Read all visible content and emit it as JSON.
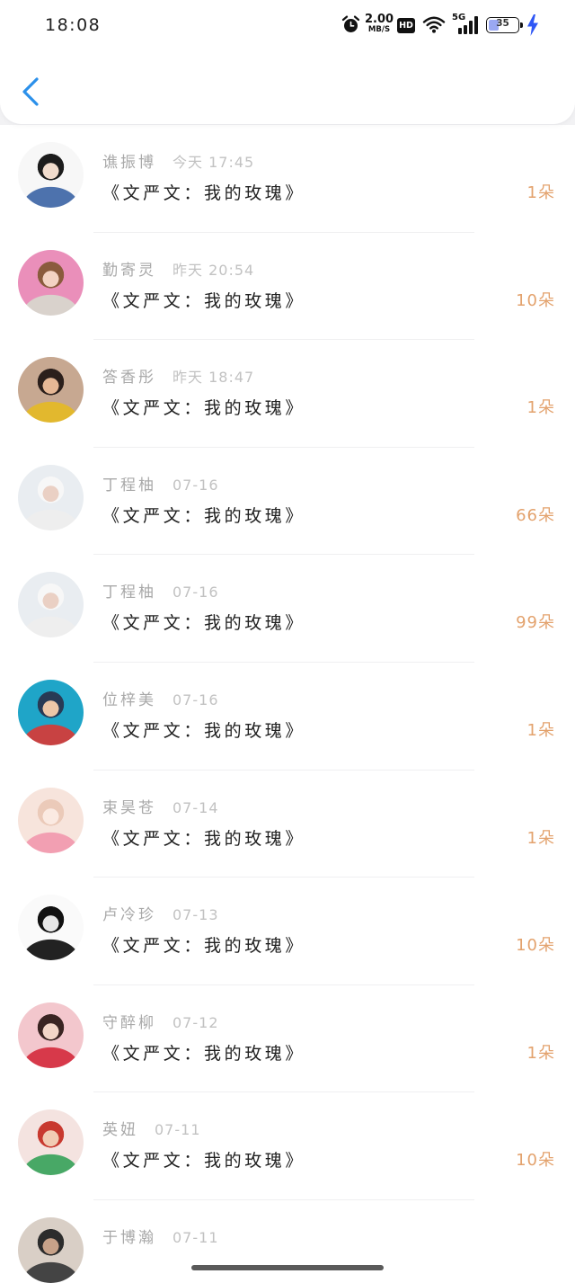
{
  "status_bar": {
    "time": "18:08",
    "net_speed_value": "2.00",
    "net_speed_unit": "MB/S",
    "hd_label": "HD",
    "network_type": "5G",
    "battery_level": "35",
    "icons": [
      "alarm-icon",
      "wifi-icon",
      "signal-icon",
      "battery-icon",
      "charging-icon"
    ]
  },
  "header": {
    "back_icon": "chevron-left-icon"
  },
  "colors": {
    "accent": "#2b90ea",
    "amount": "#e3a26d",
    "name": "#a9a9a9",
    "time": "#c2c2c2",
    "title": "#1f1f1f",
    "charging": "#2f57f5"
  },
  "list": {
    "items": [
      {
        "name": "谯振博",
        "time": "今天 17:45",
        "title": "《文严文：我的玫瑰》",
        "amount": "1朵"
      },
      {
        "name": "勤寄灵",
        "time": "昨天 20:54",
        "title": "《文严文：我的玫瑰》",
        "amount": "10朵"
      },
      {
        "name": "答香彤",
        "time": "昨天 18:47",
        "title": "《文严文：我的玫瑰》",
        "amount": "1朵"
      },
      {
        "name": "丁程柚",
        "time": "07-16",
        "title": "《文严文：我的玫瑰》",
        "amount": "66朵"
      },
      {
        "name": "丁程柚",
        "time": "07-16",
        "title": "《文严文：我的玫瑰》",
        "amount": "99朵"
      },
      {
        "name": "位梓美",
        "time": "07-16",
        "title": "《文严文：我的玫瑰》",
        "amount": "1朵"
      },
      {
        "name": "束昊苍",
        "time": "07-14",
        "title": "《文严文：我的玫瑰》",
        "amount": "1朵"
      },
      {
        "name": "卢冷珍",
        "time": "07-13",
        "title": "《文严文：我的玫瑰》",
        "amount": "10朵"
      },
      {
        "name": "守醉柳",
        "time": "07-12",
        "title": "《文严文：我的玫瑰》",
        "amount": "1朵"
      },
      {
        "name": "英妞",
        "time": "07-11",
        "title": "《文严文：我的玫瑰》",
        "amount": "10朵"
      },
      {
        "name": "于博瀚",
        "time": "07-11"
      }
    ]
  }
}
